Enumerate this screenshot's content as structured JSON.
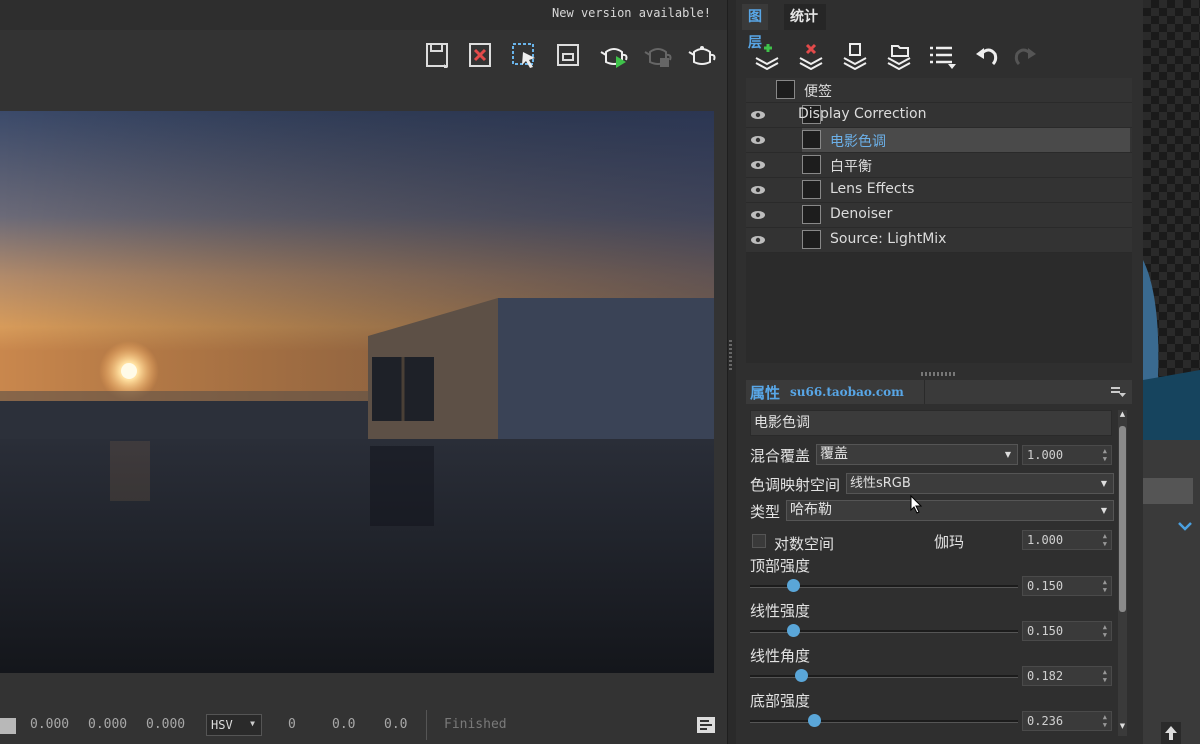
{
  "vfb": {
    "notice": "New version available!",
    "status": {
      "r": "0.000",
      "g": "0.000",
      "b": "0.000",
      "color_mode": "HSV",
      "h": "0",
      "s": "0.0",
      "v": "0.0",
      "state": "Finished"
    }
  },
  "panel": {
    "tabs": [
      "图层",
      "统计"
    ],
    "layers": [
      {
        "label": "便签",
        "eye": false,
        "icon": "note-icon"
      },
      {
        "label": "Display Correction",
        "eye": true,
        "icon": "curve-icon"
      },
      {
        "label": "电影色调",
        "eye": true,
        "icon": "filmic-tonemap-icon",
        "selected": true
      },
      {
        "label": "白平衡",
        "eye": true,
        "icon": "white-balance-icon"
      },
      {
        "label": "Lens Effects",
        "eye": true,
        "icon": "lens-effects-icon"
      },
      {
        "label": "Denoiser",
        "eye": true,
        "icon": "denoiser-icon"
      },
      {
        "label": "Source: LightMix",
        "eye": true,
        "icon": "lightmix-bulb-icon"
      }
    ],
    "properties": {
      "title": "属性",
      "watermark": "su66.taobao.com",
      "layer_name": "电影色调",
      "blend_label": "混合覆盖",
      "blend_mode": "覆盖",
      "blend_amount": "1.000",
      "tonemap_space_label": "色调映射空间",
      "tonemap_space": "线性sRGB",
      "type_label": "类型",
      "type_value": "哈布勒",
      "log_space_label": "对数空间",
      "gamma_label": "伽玛",
      "gamma_value": "1.000",
      "sliders": [
        {
          "label": "顶部强度",
          "value": "0.150",
          "fraction": 0.16
        },
        {
          "label": "线性强度",
          "value": "0.150",
          "fraction": 0.16
        },
        {
          "label": "线性角度",
          "value": "0.182",
          "fraction": 0.19
        },
        {
          "label": "底部强度",
          "value": "0.236",
          "fraction": 0.24
        }
      ]
    }
  },
  "colors": {
    "accent": "#58a6e6",
    "knob": "#5aa6d8"
  }
}
